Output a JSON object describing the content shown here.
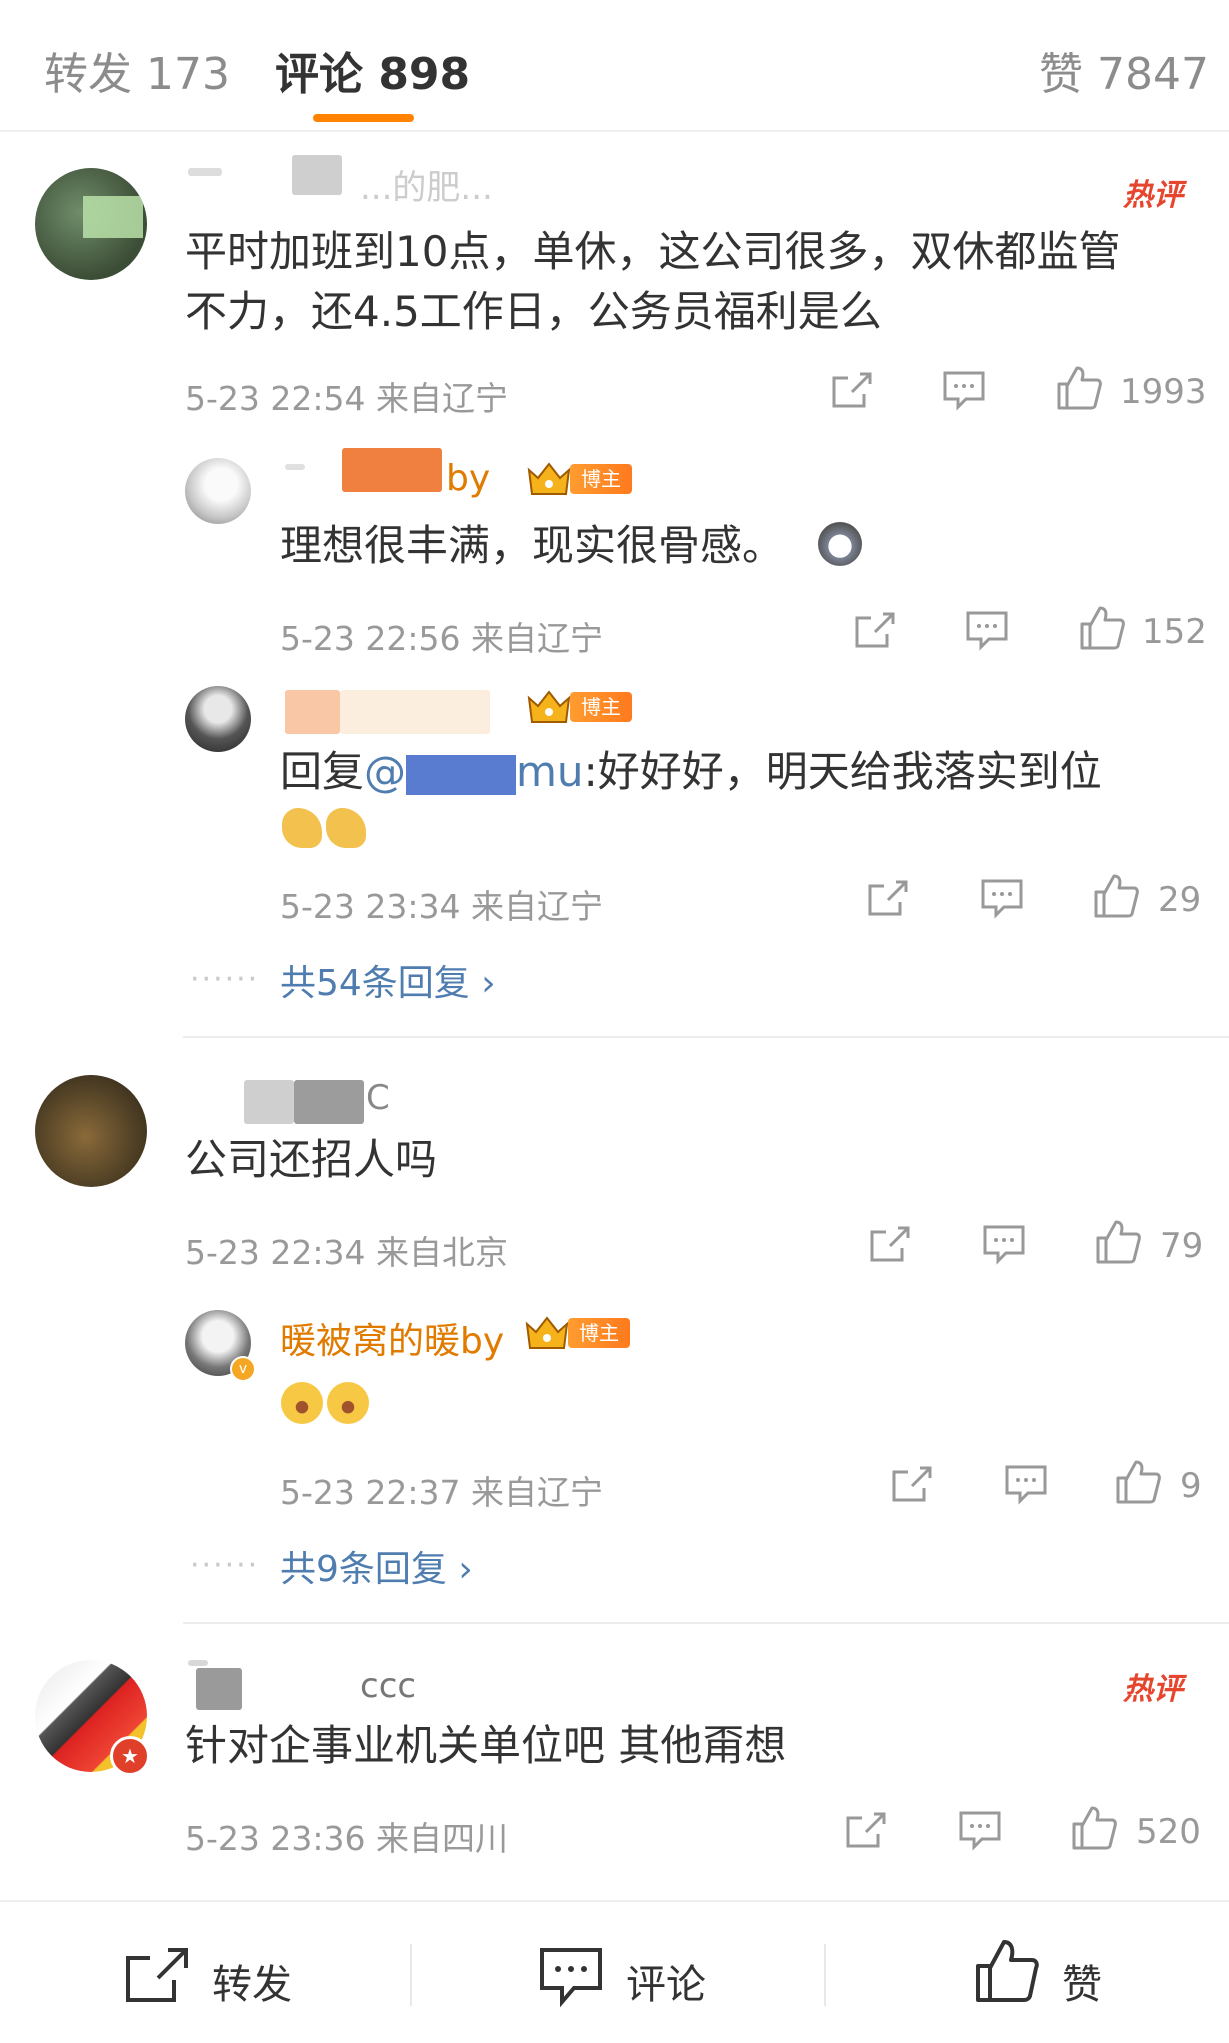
{
  "tabs": {
    "repost": "转发 173",
    "comments": "评论 898",
    "likes": "赞 7847"
  },
  "colors": {
    "accent": "#ff8200",
    "link": "#507daf",
    "hot": "#e6462e",
    "blogger_name": "#e07b00"
  },
  "hot_label": "热评",
  "blogger_badge": "博主",
  "comments": [
    {
      "name_partial": "...的肥...",
      "text_line1": "平时加班到10点，单休，这公司很多，双休都监管",
      "text_line2": "不力，还4.5工作日，公务员福利是么",
      "meta": "5-23 22:54  来自辽宁",
      "likes": "1993",
      "hot": true,
      "replies": [
        {
          "name_partial": "by",
          "text": "理想很丰满，现实很骨感。",
          "meta": "5-23 22:56  来自辽宁",
          "likes": "152"
        },
        {
          "name_partial": "",
          "text_prefix": "回复",
          "mention_at": "@",
          "mention_visible": "mu",
          "text_rest": ":好好好，明天给我落实到位",
          "meta": "5-23 23:34  来自辽宁",
          "likes": "29"
        }
      ],
      "more_replies": "共54条回复"
    },
    {
      "name_partial": "C",
      "text_line1": "公司还招人吗",
      "meta": "5-23 22:34  来自北京",
      "likes": "79",
      "hot": false,
      "replies": [
        {
          "name": "暖被窝的暖by",
          "meta": "5-23 22:37  来自辽宁",
          "likes": "9"
        }
      ],
      "more_replies": "共9条回复"
    },
    {
      "name_partial": "ccc",
      "text_line1": "针对企事业机关单位吧 其他甭想",
      "meta": "5-23 23:36  来自四川",
      "likes": "520",
      "hot": true
    }
  ],
  "bottom_bar": {
    "repost": "转发",
    "comment": "评论",
    "like": "赞"
  }
}
